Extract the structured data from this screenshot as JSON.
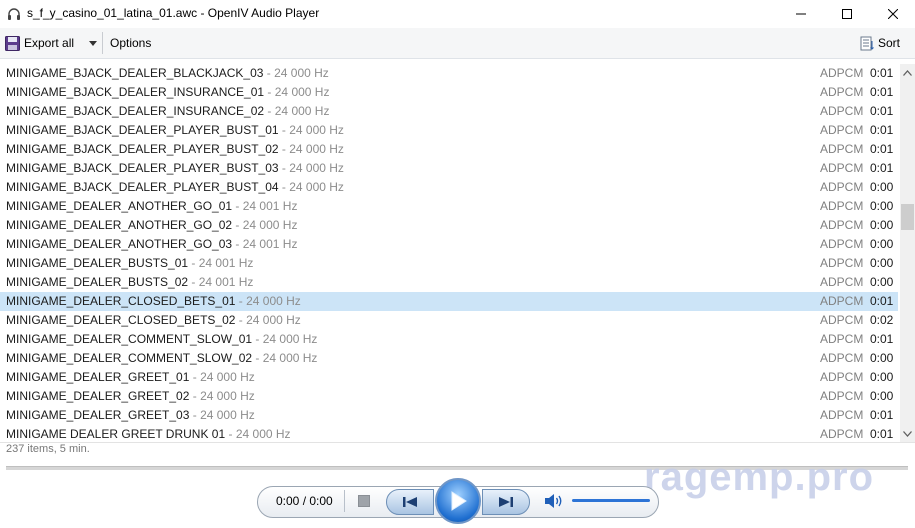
{
  "window": {
    "title": "s_f_y_casino_01_latina_01.awc - OpenIV Audio Player",
    "app_icon": "headphones-icon"
  },
  "toolbar": {
    "export_label": "Export all",
    "export_icon": "floppy-disk-icon",
    "options_label": "Options",
    "sort_label": "Sort",
    "sort_icon": "sort-list-icon"
  },
  "rows": [
    {
      "name": "MINIGAME_BJACK_DEALER_BLACKJACK_03",
      "rate": " - 24 000 Hz",
      "codec": "ADPCM",
      "duration": "0:01"
    },
    {
      "name": "MINIGAME_BJACK_DEALER_INSURANCE_01",
      "rate": " - 24 000 Hz",
      "codec": "ADPCM",
      "duration": "0:01"
    },
    {
      "name": "MINIGAME_BJACK_DEALER_INSURANCE_02",
      "rate": " - 24 000 Hz",
      "codec": "ADPCM",
      "duration": "0:01"
    },
    {
      "name": "MINIGAME_BJACK_DEALER_PLAYER_BUST_01",
      "rate": " - 24 000 Hz",
      "codec": "ADPCM",
      "duration": "0:01"
    },
    {
      "name": "MINIGAME_BJACK_DEALER_PLAYER_BUST_02",
      "rate": " - 24 000 Hz",
      "codec": "ADPCM",
      "duration": "0:01"
    },
    {
      "name": "MINIGAME_BJACK_DEALER_PLAYER_BUST_03",
      "rate": " - 24 000 Hz",
      "codec": "ADPCM",
      "duration": "0:01"
    },
    {
      "name": "MINIGAME_BJACK_DEALER_PLAYER_BUST_04",
      "rate": " - 24 000 Hz",
      "codec": "ADPCM",
      "duration": "0:00"
    },
    {
      "name": "MINIGAME_DEALER_ANOTHER_GO_01",
      "rate": " - 24 001 Hz",
      "codec": "ADPCM",
      "duration": "0:00"
    },
    {
      "name": "MINIGAME_DEALER_ANOTHER_GO_02",
      "rate": " - 24 000 Hz",
      "codec": "ADPCM",
      "duration": "0:00"
    },
    {
      "name": "MINIGAME_DEALER_ANOTHER_GO_03",
      "rate": " - 24 001 Hz",
      "codec": "ADPCM",
      "duration": "0:00"
    },
    {
      "name": "MINIGAME_DEALER_BUSTS_01",
      "rate": " - 24 001 Hz",
      "codec": "ADPCM",
      "duration": "0:00"
    },
    {
      "name": "MINIGAME_DEALER_BUSTS_02",
      "rate": " - 24 001 Hz",
      "codec": "ADPCM",
      "duration": "0:00"
    },
    {
      "name": "MINIGAME_DEALER_CLOSED_BETS_01",
      "rate": " - 24 000 Hz",
      "codec": "ADPCM",
      "duration": "0:01"
    },
    {
      "name": "MINIGAME_DEALER_CLOSED_BETS_02",
      "rate": " - 24 000 Hz",
      "codec": "ADPCM",
      "duration": "0:02"
    },
    {
      "name": "MINIGAME_DEALER_COMMENT_SLOW_01",
      "rate": " - 24 000 Hz",
      "codec": "ADPCM",
      "duration": "0:01"
    },
    {
      "name": "MINIGAME_DEALER_COMMENT_SLOW_02",
      "rate": " - 24 000 Hz",
      "codec": "ADPCM",
      "duration": "0:00"
    },
    {
      "name": "MINIGAME_DEALER_GREET_01",
      "rate": " - 24 000 Hz",
      "codec": "ADPCM",
      "duration": "0:00"
    },
    {
      "name": "MINIGAME_DEALER_GREET_02",
      "rate": " - 24 000 Hz",
      "codec": "ADPCM",
      "duration": "0:00"
    },
    {
      "name": "MINIGAME_DEALER_GREET_03",
      "rate": " - 24 000 Hz",
      "codec": "ADPCM",
      "duration": "0:01"
    },
    {
      "name": "MINIGAME DEALER GREET DRUNK 01",
      "rate": " - 24 000 Hz",
      "codec": "ADPCM",
      "duration": "0:01"
    }
  ],
  "selected_index": 12,
  "status": {
    "text": "237 items, 5 min."
  },
  "player": {
    "time": "0:00 / 0:00",
    "volume_icon": "speaker-icon",
    "stop_icon": "stop-icon",
    "prev_icon": "previous-track-icon",
    "play_icon": "play-icon",
    "next_icon": "next-track-icon"
  },
  "watermark": "ragemp.pro",
  "colors": {
    "selection": "#cce4f7",
    "accent": "#1f6fd0",
    "muted_text": "#8c8c8c"
  }
}
